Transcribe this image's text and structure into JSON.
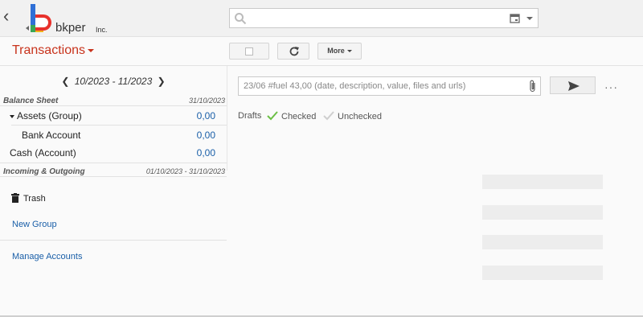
{
  "header": {
    "logo_text": "bkper",
    "logo_suffix": "Inc."
  },
  "toolbar": {
    "title": "Transactions",
    "more_label": "More"
  },
  "sidebar": {
    "period": "10/2023 - 11/2023",
    "balance_sheet": {
      "title": "Balance Sheet",
      "date": "31/10/2023"
    },
    "accounts": [
      {
        "name": "Assets (Group)",
        "value": "0,00"
      },
      {
        "name": "Bank Account",
        "value": "0,00"
      },
      {
        "name": "Cash (Account)",
        "value": "0,00"
      }
    ],
    "incoming_outgoing": {
      "title": "Incoming & Outgoing",
      "date": "01/10/2023 - 31/10/2023"
    },
    "trash_label": "Trash",
    "new_group_label": "New Group",
    "manage_accounts_label": "Manage Accounts"
  },
  "main": {
    "input_placeholder": "23/06 #fuel 43,00 (date, description, value, files and urls)",
    "filters": {
      "drafts": "Drafts",
      "checked": "Checked",
      "unchecked": "Unchecked"
    }
  },
  "colors": {
    "accent_red": "#c8331c",
    "link_blue": "#1a5fa8",
    "check_green": "#6bbf45"
  }
}
